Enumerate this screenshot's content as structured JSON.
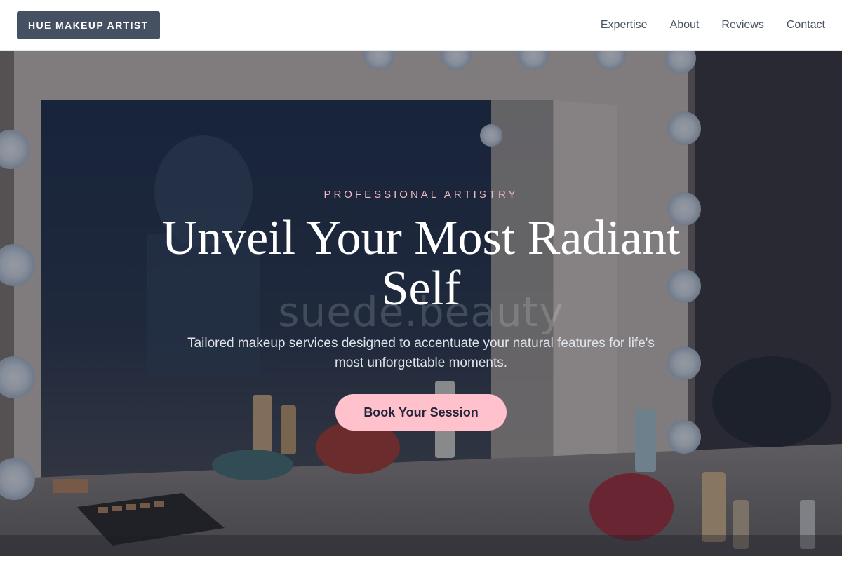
{
  "header": {
    "brand": "HUE MAKEUP ARTIST",
    "nav": [
      "Expertise",
      "About",
      "Reviews",
      "Contact"
    ]
  },
  "hero": {
    "eyebrow": "PROFESSIONAL ARTISTRY",
    "title": "Unveil Your Most Radiant Self",
    "subtitle": "Tailored makeup services designed to accentuate your natural features for life's most unforgettable moments.",
    "cta": "Book Your Session",
    "watermark": "suede.beauty"
  },
  "colors": {
    "brand_bg": "#465063",
    "accent_pink": "#ffc2cc",
    "eyebrow_pink": "#f2b8c0",
    "overlay": "#141c2e"
  }
}
